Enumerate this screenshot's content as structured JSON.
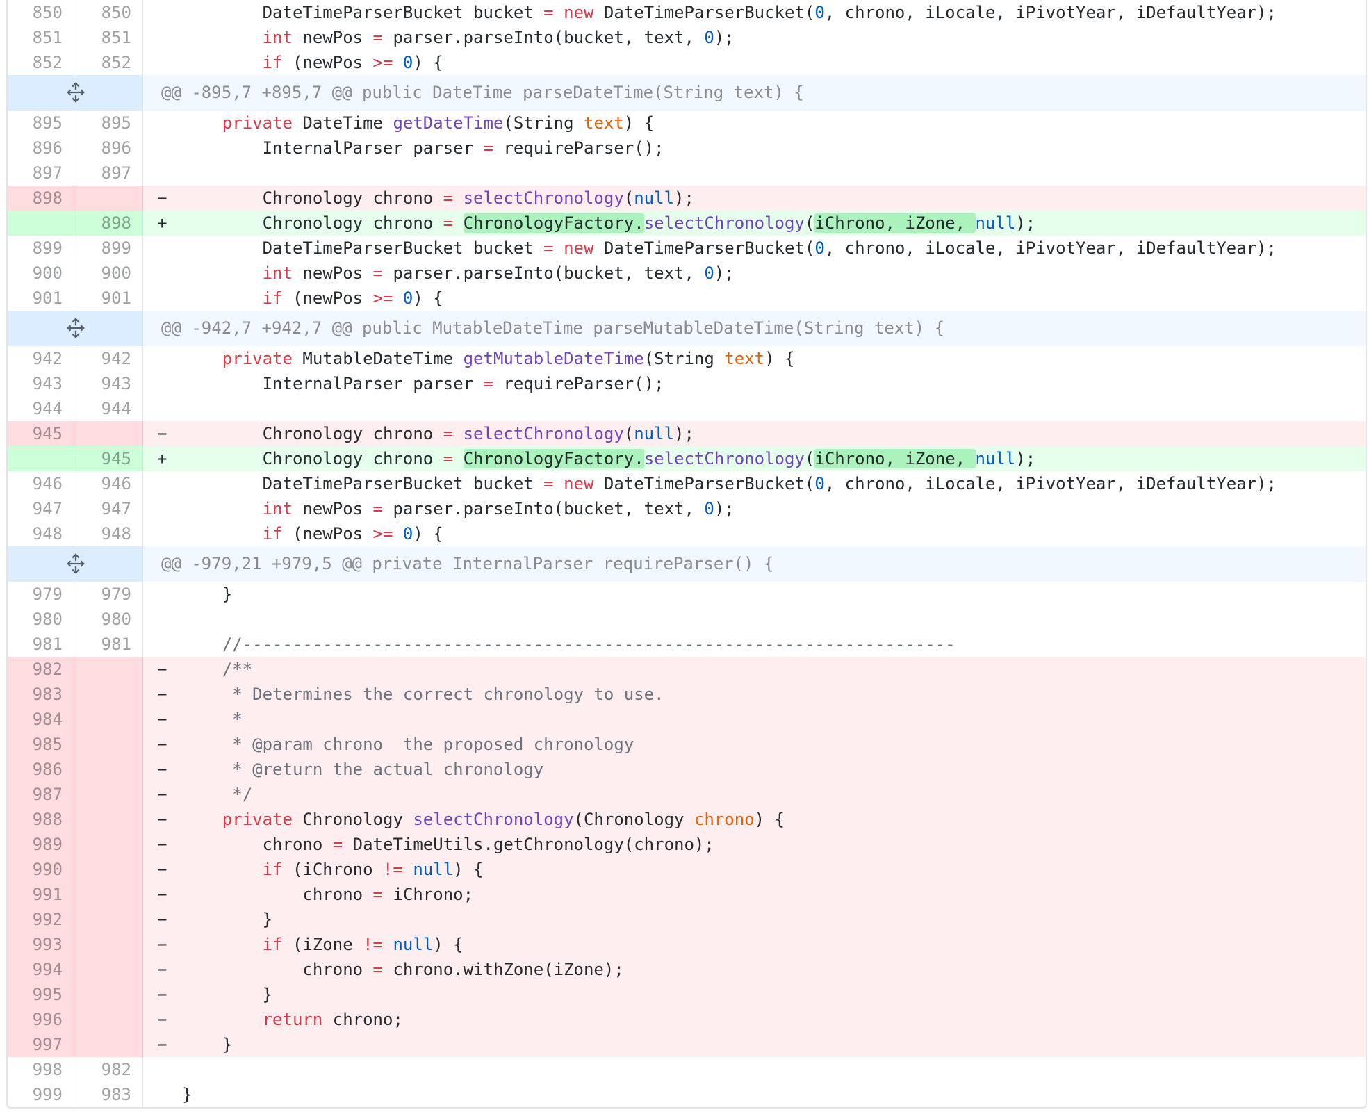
{
  "hunks": [
    {
      "header": "@@ -895,7 +895,7 @@ public DateTime parseDateTime(String text) {"
    },
    {
      "header": "@@ -942,7 +942,7 @@ public MutableDateTime parseMutableDateTime(String text) {"
    },
    {
      "header": "@@ -979,21 +979,5 @@ private InternalParser requireParser() {"
    }
  ],
  "lines": [
    {
      "old": "850",
      "new": "850",
      "type": "ctx",
      "text": "        DateTimeParserBucket bucket = new DateTimeParserBucket(0, chrono, iLocale, iPivotYear, iDefaultYear);"
    },
    {
      "old": "851",
      "new": "851",
      "type": "ctx",
      "text": "        int newPos = parser.parseInto(bucket, text, 0);"
    },
    {
      "old": "852",
      "new": "852",
      "type": "ctx",
      "text": "        if (newPos >= 0) {"
    },
    {
      "old": "895",
      "new": "895",
      "type": "ctx",
      "text": "    private DateTime getDateTime(String text) {"
    },
    {
      "old": "896",
      "new": "896",
      "type": "ctx",
      "text": "        InternalParser parser = requireParser();"
    },
    {
      "old": "897",
      "new": "897",
      "type": "ctx",
      "text": ""
    },
    {
      "old": "898",
      "new": "",
      "type": "del",
      "text": "        Chronology chrono = selectChronology(null);"
    },
    {
      "old": "",
      "new": "898",
      "type": "add",
      "text": "        Chronology chrono = ChronologyFactory.selectChronology(iChrono, iZone, null);"
    },
    {
      "old": "899",
      "new": "899",
      "type": "ctx",
      "text": "        DateTimeParserBucket bucket = new DateTimeParserBucket(0, chrono, iLocale, iPivotYear, iDefaultYear);"
    },
    {
      "old": "900",
      "new": "900",
      "type": "ctx",
      "text": "        int newPos = parser.parseInto(bucket, text, 0);"
    },
    {
      "old": "901",
      "new": "901",
      "type": "ctx",
      "text": "        if (newPos >= 0) {"
    },
    {
      "old": "942",
      "new": "942",
      "type": "ctx",
      "text": "    private MutableDateTime getMutableDateTime(String text) {"
    },
    {
      "old": "943",
      "new": "943",
      "type": "ctx",
      "text": "        InternalParser parser = requireParser();"
    },
    {
      "old": "944",
      "new": "944",
      "type": "ctx",
      "text": ""
    },
    {
      "old": "945",
      "new": "",
      "type": "del",
      "text": "        Chronology chrono = selectChronology(null);"
    },
    {
      "old": "",
      "new": "945",
      "type": "add",
      "text": "        Chronology chrono = ChronologyFactory.selectChronology(iChrono, iZone, null);"
    },
    {
      "old": "946",
      "new": "946",
      "type": "ctx",
      "text": "        DateTimeParserBucket bucket = new DateTimeParserBucket(0, chrono, iLocale, iPivotYear, iDefaultYear);"
    },
    {
      "old": "947",
      "new": "947",
      "type": "ctx",
      "text": "        int newPos = parser.parseInto(bucket, text, 0);"
    },
    {
      "old": "948",
      "new": "948",
      "type": "ctx",
      "text": "        if (newPos >= 0) {"
    },
    {
      "old": "979",
      "new": "979",
      "type": "ctx",
      "text": "    }"
    },
    {
      "old": "980",
      "new": "980",
      "type": "ctx",
      "text": ""
    },
    {
      "old": "981",
      "new": "981",
      "type": "ctx",
      "text": "    //-----------------------------------------------------------------------"
    },
    {
      "old": "982",
      "new": "",
      "type": "del",
      "text": "    /**"
    },
    {
      "old": "983",
      "new": "",
      "type": "del",
      "text": "     * Determines the correct chronology to use."
    },
    {
      "old": "984",
      "new": "",
      "type": "del",
      "text": "     *"
    },
    {
      "old": "985",
      "new": "",
      "type": "del",
      "text": "     * @param chrono  the proposed chronology"
    },
    {
      "old": "986",
      "new": "",
      "type": "del",
      "text": "     * @return the actual chronology"
    },
    {
      "old": "987",
      "new": "",
      "type": "del",
      "text": "     */"
    },
    {
      "old": "988",
      "new": "",
      "type": "del",
      "text": "    private Chronology selectChronology(Chronology chrono) {"
    },
    {
      "old": "989",
      "new": "",
      "type": "del",
      "text": "        chrono = DateTimeUtils.getChronology(chrono);"
    },
    {
      "old": "990",
      "new": "",
      "type": "del",
      "text": "        if (iChrono != null) {"
    },
    {
      "old": "991",
      "new": "",
      "type": "del",
      "text": "            chrono = iChrono;"
    },
    {
      "old": "992",
      "new": "",
      "type": "del",
      "text": "        }"
    },
    {
      "old": "993",
      "new": "",
      "type": "del",
      "text": "        if (iZone != null) {"
    },
    {
      "old": "994",
      "new": "",
      "type": "del",
      "text": "            chrono = chrono.withZone(iZone);"
    },
    {
      "old": "995",
      "new": "",
      "type": "del",
      "text": "        }"
    },
    {
      "old": "996",
      "new": "",
      "type": "del",
      "text": "        return chrono;"
    },
    {
      "old": "997",
      "new": "",
      "type": "del",
      "text": "    }"
    },
    {
      "old": "998",
      "new": "982",
      "type": "ctx",
      "text": ""
    },
    {
      "old": "999",
      "new": "983",
      "type": "ctx",
      "text": "}"
    }
  ],
  "signs": {
    "add": "+",
    "del": "−",
    "ctx": " "
  },
  "colors": {
    "del_bg": "#ffeef0",
    "add_bg": "#e6ffed",
    "hunk_bg": "#f1f8ff",
    "highlight": "#acf2bd"
  }
}
